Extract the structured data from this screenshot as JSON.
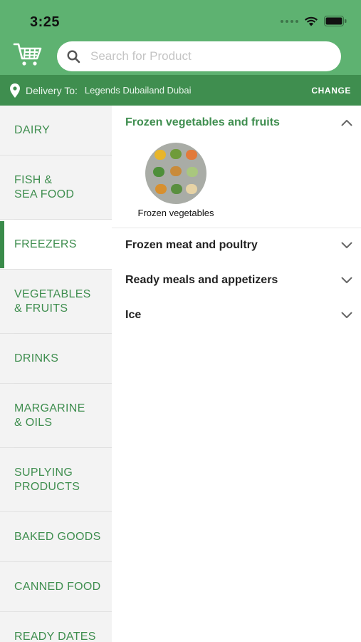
{
  "status_bar": {
    "time": "3:25"
  },
  "search": {
    "placeholder": "Search for Product"
  },
  "delivery": {
    "label": "Delivery To:",
    "location": "Legends Dubailand Dubai",
    "change_label": "CHANGE"
  },
  "sidebar": {
    "items": [
      {
        "label": "DAIRY"
      },
      {
        "label": "FISH &\nSEA FOOD"
      },
      {
        "label": "FREEZERS"
      },
      {
        "label": "VEGETABLES\n& FRUITS"
      },
      {
        "label": "DRINKS"
      },
      {
        "label": "MARGARINE\n& OILS"
      },
      {
        "label": "SUPLYING\nPRODUCTS"
      },
      {
        "label": "BAKED GOODS"
      },
      {
        "label": "CANNED FOOD"
      },
      {
        "label": "READY DATES"
      }
    ],
    "active_index": 2
  },
  "main": {
    "sections": [
      {
        "title": "Frozen vegetables and fruits",
        "expanded": true
      },
      {
        "title": "Frozen meat and poultry",
        "expanded": false
      },
      {
        "title": "Ready meals and appetizers",
        "expanded": false
      },
      {
        "title": "Ice",
        "expanded": false
      }
    ],
    "subcategories": [
      {
        "label": "Frozen vegetables"
      }
    ]
  },
  "colors": {
    "header_green": "#5eb271",
    "bar_green": "#3f8e4f",
    "accent_green": "#3a8b4a",
    "sidebar_bg": "#f3f3f3"
  },
  "icons": [
    "cart-icon",
    "search-icon",
    "location-pin-icon",
    "chevron-up-icon",
    "chevron-down-icon",
    "wifi-icon",
    "battery-icon",
    "signal-icon"
  ]
}
